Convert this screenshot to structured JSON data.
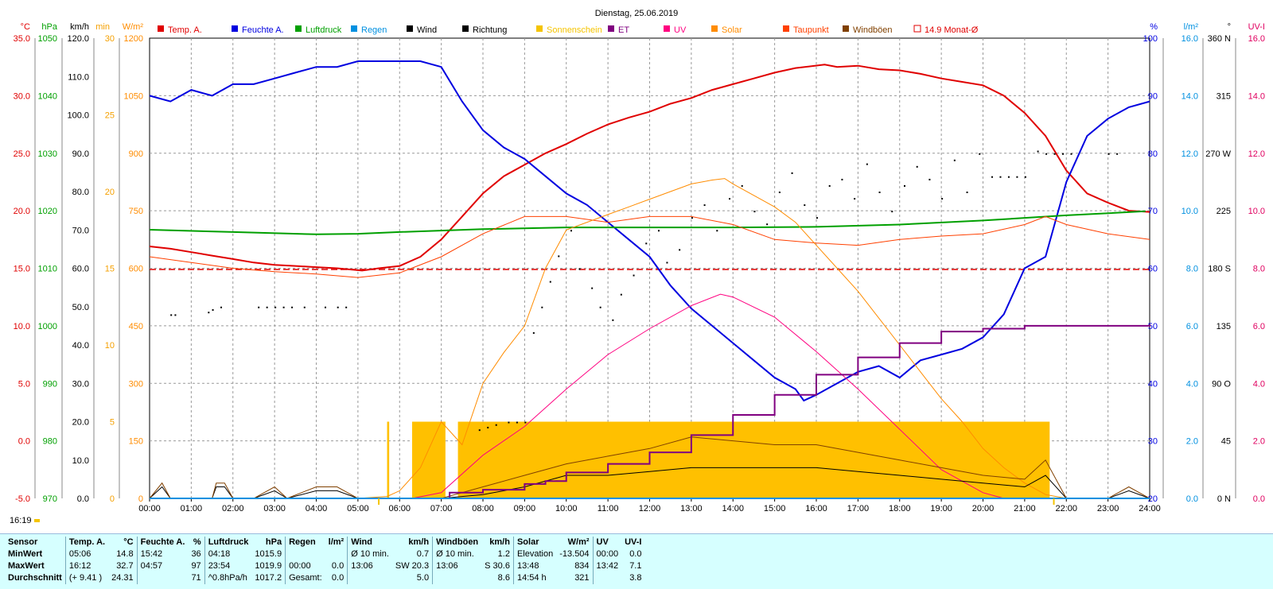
{
  "timestamp": "16:19",
  "chart_data": {
    "type": "line",
    "title": "Dienstag, 25.06.2019",
    "x_ticks": [
      "00:00",
      "01:00",
      "02:00",
      "03:00",
      "04:00",
      "05:00",
      "06:00",
      "07:00",
      "08:00",
      "09:00",
      "10:00",
      "11:00",
      "12:00",
      "13:00",
      "14:00",
      "15:00",
      "16:00",
      "17:00",
      "18:00",
      "19:00",
      "20:00",
      "21:00",
      "22:00",
      "23:00",
      "24:00"
    ],
    "xlim": [
      0,
      24
    ],
    "grid": true,
    "legend_placement": "top",
    "legend": [
      {
        "label": "Temp. A.",
        "color": "#e00000",
        "type": "box"
      },
      {
        "label": "Feuchte A.",
        "color": "#0000e0",
        "type": "box"
      },
      {
        "label": "Luftdruck",
        "color": "#00a000",
        "type": "box"
      },
      {
        "label": "Regen",
        "color": "#0090e0",
        "type": "box"
      },
      {
        "label": "Wind",
        "color": "#000000",
        "type": "box"
      },
      {
        "label": "Richtung",
        "color": "#000000",
        "type": "box"
      },
      {
        "label": "Sonnenschein",
        "color": "#f5c400",
        "type": "box"
      },
      {
        "label": "ET",
        "color": "#800080",
        "type": "box"
      },
      {
        "label": "UV",
        "color": "#ff0080",
        "type": "box"
      },
      {
        "label": "Solar",
        "color": "#ff8c00",
        "type": "box"
      },
      {
        "label": "Taupunkt",
        "color": "#ff4000",
        "type": "box"
      },
      {
        "label": "Windböen",
        "color": "#804000",
        "type": "box"
      },
      {
        "label": "14.9 Monat-Ø",
        "color": "#e00000",
        "type": "outline"
      }
    ],
    "axes_left": [
      {
        "unit": "°C",
        "color": "#e00000",
        "ticks": [
          "35.0",
          "30.0",
          "25.0",
          "20.0",
          "15.0",
          "10.0",
          "5.0",
          "0.0",
          "-5.0"
        ]
      },
      {
        "unit": "hPa",
        "color": "#00a000",
        "ticks": [
          "1050",
          "1040",
          "1030",
          "1020",
          "1010",
          "1000",
          "990",
          "980",
          "970"
        ]
      },
      {
        "unit": "km/h",
        "color": "#000000",
        "ticks": [
          "120.0",
          "110.0",
          "100.0",
          "90.0",
          "80.0",
          "70.0",
          "60.0",
          "50.0",
          "40.0",
          "30.0",
          "20.0",
          "10.0",
          "0.0"
        ]
      },
      {
        "unit": "min",
        "color": "#f5a000",
        "ticks": [
          "30",
          "25",
          "20",
          "15",
          "10",
          "5",
          "0"
        ]
      },
      {
        "unit": "W/m²",
        "color": "#ff8c00",
        "ticks": [
          "1200",
          "1050",
          "900",
          "750",
          "600",
          "450",
          "300",
          "150",
          "0"
        ]
      }
    ],
    "axes_right": [
      {
        "unit": "%",
        "color": "#0000e0",
        "ticks": [
          "100",
          "90",
          "80",
          "70",
          "60",
          "50",
          "40",
          "30",
          "20"
        ]
      },
      {
        "unit": "l/m²",
        "color": "#0090e0",
        "ticks": [
          "16.0",
          "14.0",
          "12.0",
          "10.0",
          "8.0",
          "6.0",
          "4.0",
          "2.0",
          "0.0"
        ]
      },
      {
        "unit": "°",
        "color": "#000000",
        "ticks": [
          "360 N",
          "315",
          "270 W",
          "225",
          "180 S",
          "135",
          "90 O",
          "45",
          "0 N"
        ]
      },
      {
        "unit": "UV-I",
        "color": "#e00060",
        "ticks": [
          "16.0",
          "14.0",
          "12.0",
          "10.0",
          "8.0",
          "6.0",
          "4.0",
          "2.0",
          "0.0"
        ]
      }
    ],
    "reference_line": {
      "label": "14.9 Monat-Ø",
      "value": 14.9,
      "color": "#e00000"
    },
    "series": [
      {
        "name": "Temp. A.",
        "color": "#e00000",
        "unit": "°C",
        "x": [
          0,
          0.5,
          1,
          1.5,
          2,
          2.5,
          3,
          3.5,
          4,
          4.5,
          5.1,
          5.5,
          6,
          6.5,
          7,
          7.5,
          8,
          8.5,
          9,
          9.5,
          10,
          10.5,
          11,
          11.5,
          12,
          12.5,
          13,
          13.5,
          14,
          14.5,
          15,
          15.5,
          16.2,
          16.5,
          17,
          17.5,
          18,
          18.5,
          19,
          19.5,
          20,
          20.5,
          21,
          21.5,
          22,
          22.5,
          23,
          23.5,
          24
        ],
        "y": [
          16.9,
          16.7,
          16.4,
          16.1,
          15.8,
          15.5,
          15.3,
          15.2,
          15.1,
          15.0,
          14.8,
          15.0,
          15.2,
          16.0,
          17.5,
          19.5,
          21.5,
          23.0,
          24.0,
          25.0,
          25.8,
          26.7,
          27.5,
          28.1,
          28.6,
          29.3,
          29.8,
          30.5,
          31.0,
          31.5,
          32.0,
          32.4,
          32.7,
          32.5,
          32.6,
          32.3,
          32.2,
          31.9,
          31.5,
          31.2,
          30.9,
          30.0,
          28.5,
          26.5,
          23.5,
          21.5,
          20.7,
          20.0,
          19.9
        ]
      },
      {
        "name": "Feuchte A.",
        "color": "#0000e0",
        "unit": "%",
        "x": [
          0,
          0.5,
          1,
          1.5,
          2,
          2.5,
          3,
          3.5,
          4,
          4.5,
          5,
          5.5,
          6,
          6.5,
          7,
          7.5,
          8,
          8.5,
          9,
          9.5,
          10,
          10.5,
          11,
          11.5,
          12,
          12.5,
          13,
          13.5,
          14,
          14.5,
          15,
          15.5,
          15.7,
          16,
          16.5,
          17,
          17.5,
          18,
          18.5,
          19,
          19.5,
          20,
          20.5,
          21,
          21.5,
          22,
          22.5,
          23,
          23.5,
          24
        ],
        "y": [
          90,
          89,
          91,
          90,
          92,
          92,
          93,
          94,
          95,
          95,
          96,
          96,
          96,
          96,
          95,
          89,
          84,
          81,
          79,
          76,
          73,
          71,
          68,
          65,
          62,
          57,
          53,
          50,
          47,
          44,
          41,
          39,
          37,
          38,
          40,
          42,
          43,
          41,
          44,
          45,
          46,
          48,
          52,
          60,
          62,
          75,
          83,
          86,
          88,
          89
        ]
      },
      {
        "name": "Luftdruck",
        "color": "#00a000",
        "unit": "hPa",
        "x": [
          0,
          2,
          4,
          5,
          6,
          8,
          10,
          12,
          14,
          16,
          18,
          20,
          22,
          23.9
        ],
        "y": [
          1016.7,
          1016.3,
          1015.9,
          1016.0,
          1016.3,
          1016.8,
          1017.1,
          1017.1,
          1017.1,
          1017.2,
          1017.6,
          1018.3,
          1019.2,
          1019.9
        ]
      },
      {
        "name": "Taupunkt",
        "color": "#ff4000",
        "unit": "°C",
        "x": [
          0,
          1,
          2,
          3,
          4,
          5,
          6,
          7,
          8,
          9,
          10,
          11,
          12,
          13,
          14,
          15,
          16,
          17,
          18,
          19,
          20,
          21,
          21.5,
          22,
          23,
          24
        ],
        "y": [
          16.0,
          15.5,
          15.0,
          14.7,
          14.5,
          14.2,
          14.6,
          16.0,
          18.0,
          19.5,
          19.5,
          19.0,
          19.5,
          19.5,
          18.8,
          17.5,
          17.2,
          17.0,
          17.5,
          17.8,
          18.0,
          18.8,
          19.5,
          18.8,
          18.0,
          17.5
        ]
      },
      {
        "name": "Solar",
        "color": "#ff8c00",
        "unit": "W/m²",
        "x": [
          0,
          5,
          5.7,
          6,
          6.5,
          7,
          7.5,
          8,
          8.5,
          9,
          9.5,
          10,
          10.5,
          11,
          11.5,
          12,
          12.5,
          13,
          13.5,
          13.8,
          14,
          14.5,
          15,
          15.5,
          16,
          16.5,
          17,
          17.5,
          18,
          18.5,
          19,
          19.5,
          20,
          20.5,
          21,
          21.5,
          22
        ],
        "y": [
          0,
          0,
          5,
          20,
          80,
          200,
          140,
          300,
          380,
          450,
          600,
          700,
          720,
          740,
          760,
          780,
          800,
          820,
          830,
          834,
          820,
          790,
          760,
          720,
          660,
          600,
          540,
          470,
          400,
          330,
          260,
          200,
          130,
          80,
          40,
          10,
          0
        ]
      },
      {
        "name": "UV",
        "color": "#ff0080",
        "unit": "UV-I",
        "x": [
          0,
          6.3,
          7,
          8,
          9,
          10,
          11,
          12,
          13,
          13.7,
          14,
          15,
          16,
          17,
          18,
          19,
          20,
          20.5,
          24
        ],
        "y": [
          0,
          0,
          0.2,
          1.5,
          2.5,
          3.8,
          5.0,
          5.9,
          6.7,
          7.1,
          7.0,
          6.3,
          5.1,
          3.8,
          2.4,
          1.0,
          0.2,
          0,
          0
        ]
      },
      {
        "name": "Wind",
        "color": "#000000",
        "unit": "km/h",
        "x": [
          0,
          0.3,
          0.5,
          1.5,
          1.6,
          1.8,
          2,
          2.5,
          3,
          3.3,
          4,
          4.5,
          5,
          6,
          7,
          8,
          9,
          10,
          11,
          12,
          13,
          14,
          15,
          16,
          17,
          18,
          19,
          20,
          21,
          21.5,
          22,
          23,
          23.5,
          24
        ],
        "y": [
          0,
          3,
          0,
          0,
          3,
          3,
          0,
          0,
          2,
          0,
          2,
          2,
          0,
          0,
          0,
          1,
          3,
          6,
          6,
          7,
          8,
          8,
          8,
          8,
          7,
          6,
          5,
          4,
          3,
          6,
          0,
          0,
          2,
          0
        ]
      },
      {
        "name": "Windböen",
        "color": "#804000",
        "unit": "km/h",
        "x": [
          0,
          0.3,
          0.5,
          1.5,
          1.6,
          1.8,
          2,
          2.5,
          3,
          3.3,
          4,
          4.5,
          5,
          6,
          7,
          8,
          9,
          10,
          11,
          12,
          13,
          14,
          15,
          16,
          17,
          18,
          19,
          20,
          21,
          21.5,
          22,
          23,
          23.5,
          24
        ],
        "y": [
          0,
          4,
          0,
          0,
          4,
          4,
          0,
          0,
          3,
          0,
          3,
          3,
          0,
          0,
          0,
          3,
          6,
          9,
          11,
          13,
          16,
          15,
          14,
          14,
          12,
          10,
          8,
          6,
          5,
          10,
          0,
          0,
          3,
          0
        ]
      },
      {
        "name": "ET",
        "color": "#800080",
        "unit": "l/m²",
        "x": [
          0,
          7.2,
          7.2,
          8,
          9,
          9.5,
          10,
          11,
          12,
          13,
          14,
          15,
          16,
          17,
          18,
          19,
          20,
          21,
          22,
          24
        ],
        "y": [
          0,
          0,
          0.2,
          0.3,
          0.5,
          0.6,
          0.9,
          1.2,
          1.6,
          2.2,
          2.9,
          3.6,
          4.3,
          4.9,
          5.4,
          5.8,
          5.9,
          6.0,
          6.0,
          6.05
        ]
      },
      {
        "name": "Regen",
        "color": "#0090e0",
        "unit": "l/m²",
        "x": [
          0,
          24
        ],
        "y": [
          0,
          0
        ]
      }
    ],
    "sunshine_blocks": [
      {
        "from": 5.7,
        "to": 5.75,
        "minutes": 5
      },
      {
        "from": 6.3,
        "to": 7.1,
        "minutes": 5
      },
      {
        "from": 7.4,
        "to": 21.6,
        "minutes": 5
      }
    ],
    "direction_points": [
      {
        "x": 0.5,
        "y": 144
      },
      {
        "x": 0.6,
        "y": 144
      },
      {
        "x": 1.4,
        "y": 146
      },
      {
        "x": 1.5,
        "y": 148
      },
      {
        "x": 1.7,
        "y": 150
      },
      {
        "x": 2.6,
        "y": 150
      },
      {
        "x": 2.8,
        "y": 150
      },
      {
        "x": 3.0,
        "y": 150
      },
      {
        "x": 3.2,
        "y": 150
      },
      {
        "x": 3.4,
        "y": 150
      },
      {
        "x": 3.7,
        "y": 150
      },
      {
        "x": 4.2,
        "y": 150
      },
      {
        "x": 4.5,
        "y": 150
      },
      {
        "x": 4.7,
        "y": 150
      },
      {
        "x": 7.9,
        "y": 54
      },
      {
        "x": 8.1,
        "y": 56
      },
      {
        "x": 8.3,
        "y": 58
      },
      {
        "x": 8.6,
        "y": 60
      },
      {
        "x": 8.8,
        "y": 60
      },
      {
        "x": 9.0,
        "y": 60
      },
      {
        "x": 9.2,
        "y": 130
      },
      {
        "x": 9.4,
        "y": 150
      },
      {
        "x": 9.6,
        "y": 170
      },
      {
        "x": 9.8,
        "y": 190
      },
      {
        "x": 10.1,
        "y": 210
      },
      {
        "x": 10.3,
        "y": 180
      },
      {
        "x": 10.6,
        "y": 165
      },
      {
        "x": 10.8,
        "y": 150
      },
      {
        "x": 11.1,
        "y": 140
      },
      {
        "x": 11.3,
        "y": 160
      },
      {
        "x": 11.6,
        "y": 175
      },
      {
        "x": 11.9,
        "y": 200
      },
      {
        "x": 12.2,
        "y": 210
      },
      {
        "x": 12.4,
        "y": 185
      },
      {
        "x": 12.7,
        "y": 195
      },
      {
        "x": 13.0,
        "y": 220
      },
      {
        "x": 13.3,
        "y": 230
      },
      {
        "x": 13.6,
        "y": 210
      },
      {
        "x": 13.9,
        "y": 235
      },
      {
        "x": 14.2,
        "y": 245
      },
      {
        "x": 14.5,
        "y": 225
      },
      {
        "x": 14.8,
        "y": 215
      },
      {
        "x": 15.1,
        "y": 240
      },
      {
        "x": 15.4,
        "y": 255
      },
      {
        "x": 15.7,
        "y": 230
      },
      {
        "x": 16.0,
        "y": 220
      },
      {
        "x": 16.3,
        "y": 245
      },
      {
        "x": 16.6,
        "y": 250
      },
      {
        "x": 16.9,
        "y": 235
      },
      {
        "x": 17.2,
        "y": 262
      },
      {
        "x": 17.5,
        "y": 240
      },
      {
        "x": 17.8,
        "y": 225
      },
      {
        "x": 18.1,
        "y": 245
      },
      {
        "x": 18.4,
        "y": 260
      },
      {
        "x": 18.7,
        "y": 250
      },
      {
        "x": 19.0,
        "y": 235
      },
      {
        "x": 19.3,
        "y": 265
      },
      {
        "x": 19.6,
        "y": 240
      },
      {
        "x": 19.9,
        "y": 270
      },
      {
        "x": 20.2,
        "y": 252
      },
      {
        "x": 20.4,
        "y": 252
      },
      {
        "x": 20.6,
        "y": 252
      },
      {
        "x": 20.8,
        "y": 252
      },
      {
        "x": 21.0,
        "y": 252
      },
      {
        "x": 21.3,
        "y": 272
      },
      {
        "x": 21.5,
        "y": 270
      },
      {
        "x": 21.7,
        "y": 270
      },
      {
        "x": 21.9,
        "y": 270
      },
      {
        "x": 22.1,
        "y": 270
      },
      {
        "x": 23.0,
        "y": 270
      },
      {
        "x": 23.2,
        "y": 270
      }
    ],
    "bottom_markers": [
      {
        "x": 5.5,
        "color": "#f5c400"
      },
      {
        "x": 21.7,
        "color": "#f5c400"
      }
    ]
  },
  "summary": {
    "header": [
      "Sensor",
      "Temp. A.",
      "°C",
      "Feuchte A.",
      "%",
      "Luftdruck",
      "hPa",
      "Regen",
      "l/m²",
      "Wind",
      "km/h",
      "Windböen",
      "km/h",
      "Solar",
      "W/m²",
      "UV",
      "UV-I"
    ],
    "rows": [
      [
        "MinWert",
        "05:06",
        "14.8",
        "15:42",
        "36",
        "04:18",
        "1015.9",
        "",
        "",
        "Ø 10 min.",
        "0.7",
        "Ø 10 min.",
        "1.2",
        "Elevation",
        "-13.504",
        "00:00",
        "0.0"
      ],
      [
        "MaxWert",
        "16:12",
        "32.7",
        "04:57",
        "97",
        "23:54",
        "1019.9",
        "00:00",
        "0.0",
        "13:06",
        "SW 20.3",
        "13:06",
        "S 30.6",
        "13:48",
        "834",
        "13:42",
        "7.1"
      ],
      [
        "Durchschnitt",
        "(+ 9.41 )",
        "24.31",
        "",
        "71",
        "^0.8hPa/h",
        "1017.2",
        "Gesamt:",
        "0.0",
        "",
        "5.0",
        "",
        "8.6",
        "14:54 h",
        "321",
        "",
        "3.8"
      ]
    ]
  }
}
